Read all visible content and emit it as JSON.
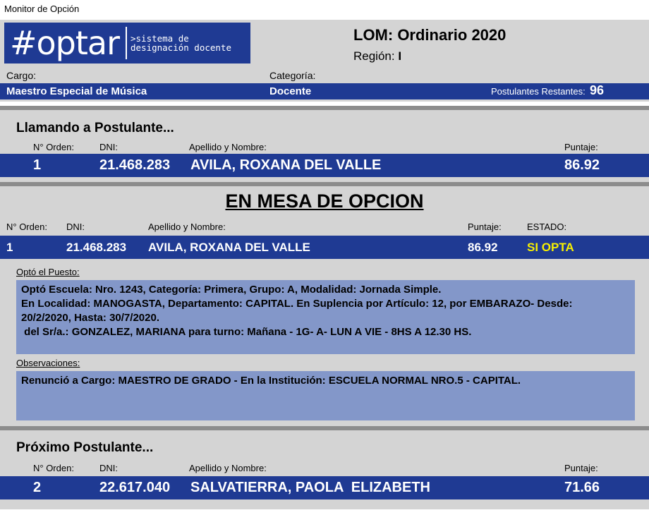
{
  "window": {
    "title": "Monitor de Opción"
  },
  "logo": {
    "mark": "#optar",
    "tagline": ">sistema de\ndesignación docente"
  },
  "header": {
    "title": "LOM: Ordinario 2020",
    "region_label": "Región:",
    "region_value": "I",
    "cargo_label": "Cargo:",
    "cargo_value": "Maestro Especial de Música",
    "categoria_label": "Categoría:",
    "categoria_value": "Docente",
    "restantes_label": "Postulantes Restantes:",
    "restantes_value": "96"
  },
  "calling": {
    "title": "Llamando a Postulante...",
    "headers": {
      "orden": "N° Orden:",
      "dni": "DNI:",
      "nombre": "Apellido y Nombre:",
      "puntaje": "Puntaje:"
    },
    "row": {
      "orden": "1",
      "dni": "21.468.283",
      "nombre": "AVILA, ROXANA DEL VALLE",
      "puntaje": "86.92"
    }
  },
  "mesa": {
    "title": "EN MESA DE OPCION",
    "headers": {
      "orden": "N° Orden:",
      "dni": "DNI:",
      "nombre": "Apellido y Nombre:",
      "puntaje": "Puntaje:",
      "estado": "ESTADO:"
    },
    "row": {
      "orden": "1",
      "dni": "21.468.283",
      "nombre": "AVILA, ROXANA DEL VALLE",
      "puntaje": "86.92",
      "estado": "SI OPTA"
    },
    "opto_label": "Optó el Puesto:",
    "opto_lines": [
      "Optó Escuela: Nro. 1243, Categoría: Primera, Grupo: A, Modalidad: Jornada Simple.",
      "En Localidad: MANOGASTA, Departamento: CAPITAL. En Suplencia por Artículo: 12, por EMBARAZO- Desde:",
      "20/2/2020, Hasta: 30/7/2020.",
      " del Sr/a.: GONZALEZ, MARIANA para turno: Mañana - 1G- A- LUN A VIE - 8HS A 12.30 HS."
    ],
    "obs_label": "Observaciones:",
    "obs_text": "Renunció a Cargo: MAESTRO DE GRADO - En la Institución: ESCUELA NORMAL NRO.5 - CAPITAL."
  },
  "next": {
    "title": "Próximo Postulante...",
    "headers": {
      "orden": "N° Orden:",
      "dni": "DNI:",
      "nombre": "Apellido y Nombre:",
      "puntaje": "Puntaje:"
    },
    "row": {
      "orden": "2",
      "dni": "22.617.040",
      "nombre": "SALVATIERRA, PAOLA  ELIZABETH",
      "puntaje": "71.66"
    }
  },
  "colors": {
    "navy": "#1f3a93",
    "panel": "#d4d4d4",
    "light_box": "#8397c9",
    "estado_yellow": "#f7ef00",
    "divider": "#8c8c8c"
  }
}
